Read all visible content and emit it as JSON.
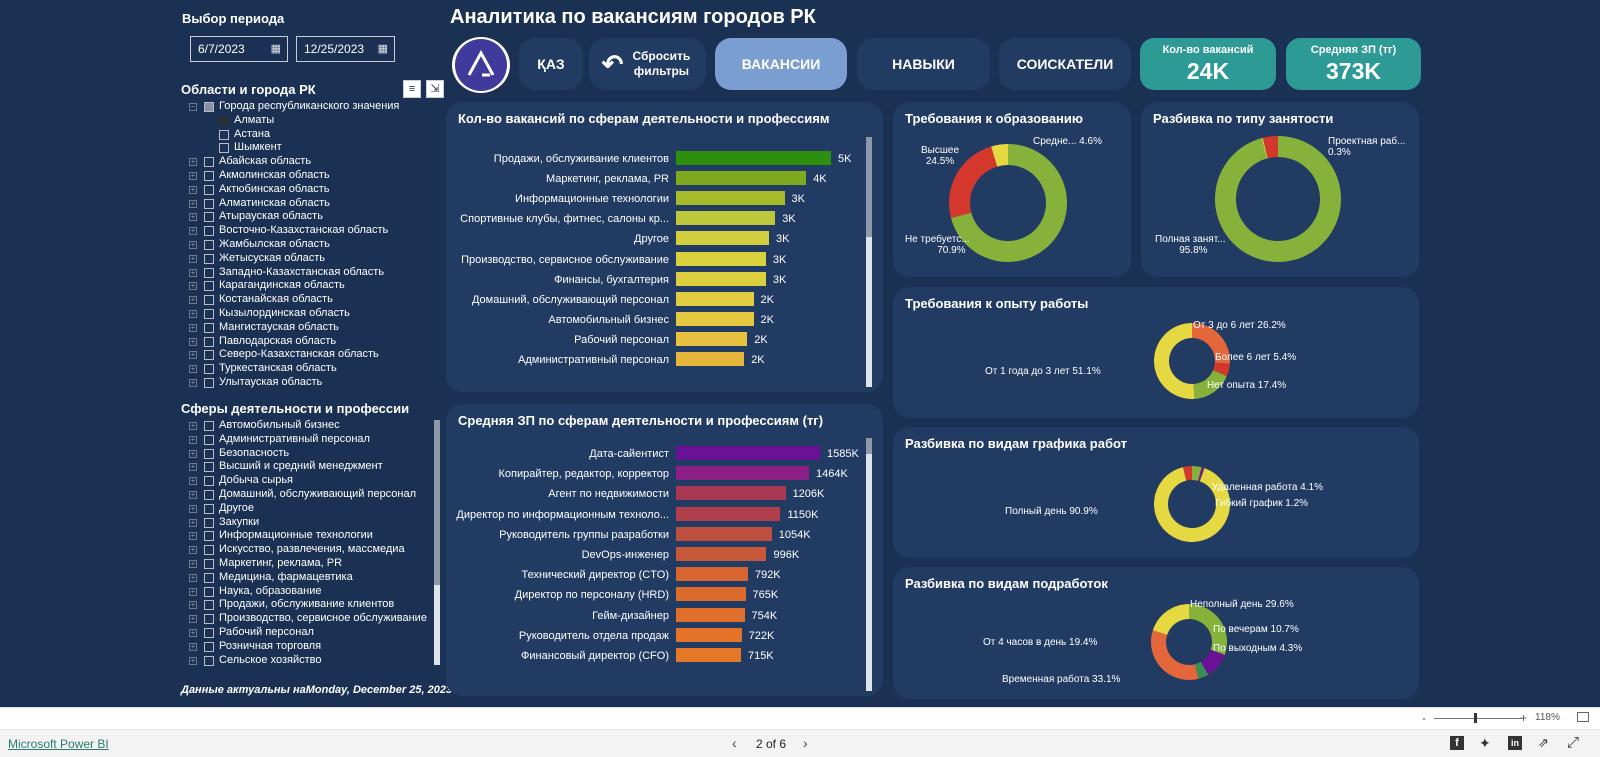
{
  "title": "Аналитика по вакансиям городов РК",
  "period": {
    "label": "Выбор периода",
    "start": "6/7/2023",
    "end": "12/25/2023"
  },
  "regions": {
    "label": "Области и города РК",
    "items": [
      {
        "label": "Города республиканского значения",
        "level": 0,
        "state": "partial"
      },
      {
        "label": "Алматы",
        "level": 1,
        "state": "filled"
      },
      {
        "label": "Астана",
        "level": 1,
        "state": "empty"
      },
      {
        "label": "Шымкент",
        "level": 1,
        "state": "empty"
      },
      {
        "label": "Абайская область",
        "level": 0,
        "state": "empty"
      },
      {
        "label": "Акмолинская область",
        "level": 0,
        "state": "empty"
      },
      {
        "label": "Актюбинская область",
        "level": 0,
        "state": "empty"
      },
      {
        "label": "Алматинская область",
        "level": 0,
        "state": "empty"
      },
      {
        "label": "Атырауская область",
        "level": 0,
        "state": "empty"
      },
      {
        "label": "Восточно-Казахстанская область",
        "level": 0,
        "state": "empty"
      },
      {
        "label": "Жамбылская область",
        "level": 0,
        "state": "empty"
      },
      {
        "label": "Жетысуская область",
        "level": 0,
        "state": "empty"
      },
      {
        "label": "Западно-Казахстанская область",
        "level": 0,
        "state": "empty"
      },
      {
        "label": "Карагандинская область",
        "level": 0,
        "state": "empty"
      },
      {
        "label": "Костанайская область",
        "level": 0,
        "state": "empty"
      },
      {
        "label": "Кызылординская область",
        "level": 0,
        "state": "empty"
      },
      {
        "label": "Мангистауская область",
        "level": 0,
        "state": "empty"
      },
      {
        "label": "Павлодарская область",
        "level": 0,
        "state": "empty"
      },
      {
        "label": "Северо-Казахстанская область",
        "level": 0,
        "state": "empty"
      },
      {
        "label": "Туркестанская область",
        "level": 0,
        "state": "empty"
      },
      {
        "label": "Улытауская область",
        "level": 0,
        "state": "empty"
      }
    ]
  },
  "spheres": {
    "label": "Сферы деятельности и профессии",
    "items": [
      "Автомобильный бизнес",
      "Административный персонал",
      "Безопасность",
      "Высший и средний менеджмент",
      "Добыча сырья",
      "Домашний, обслуживающий персонал",
      "Другое",
      "Закупки",
      "Информационные технологии",
      "Искусство, развлечения, массмедиа",
      "Маркетинг, реклама, PR",
      "Медицина, фармацевтика",
      "Наука, образование",
      "Продажи, обслуживание клиентов",
      "Производство, сервисное обслуживание",
      "Рабочий персонал",
      "Розничная торговля",
      "Сельское хозяйство"
    ]
  },
  "updated": {
    "prefix": "Данные актуальны на",
    "date": "Monday, December 25, 2023"
  },
  "nav": {
    "lang": "ҚАЗ",
    "reset": "Сбросить фильтры",
    "vacancies": "ВАКАНСИИ",
    "skills": "НАВЫКИ",
    "applicants": "СОИСКАТЕЛИ"
  },
  "kpis": [
    {
      "label": "Кол-во вакансий",
      "value": "24K"
    },
    {
      "label": "Средняя ЗП (тг)",
      "value": "373K"
    }
  ],
  "colors": {
    "background": "#1b3153",
    "card": "#223b63",
    "kpi": "#2e9a95",
    "active_tab": "#7b9ed0"
  },
  "chart_data": [
    {
      "id": "vacancies_by_sphere",
      "type": "bar",
      "orientation": "horizontal",
      "title": "Кол-во вакансий по сферам деятельности и профессиям",
      "categories": [
        "Продажи, обслуживание клиентов",
        "Маркетинг, реклама, PR",
        "Информационные технологии",
        "Спортивные клубы, фитнес, салоны кр...",
        "Другое",
        "Производство, сервисное обслуживание",
        "Финансы, бухгалтерия",
        "Домашний, обслуживающий персонал",
        "Автомобильный бизнес",
        "Рабочий персонал",
        "Административный персонал"
      ],
      "values": [
        5000,
        4200,
        3500,
        3200,
        3000,
        2900,
        2900,
        2500,
        2500,
        2300,
        2200
      ],
      "labels": [
        "5K",
        "4K",
        "3K",
        "3K",
        "3K",
        "3K",
        "3K",
        "2K",
        "2K",
        "2K",
        "2K"
      ],
      "colors": [
        "#2e8f0f",
        "#7fa91e",
        "#a6bc2b",
        "#bec63a",
        "#d2cf3e",
        "#d9d23c",
        "#dccf3d",
        "#e2cc42",
        "#e4c840",
        "#e6c240",
        "#e6b63a"
      ]
    },
    {
      "id": "salary_by_sphere",
      "type": "bar",
      "orientation": "horizontal",
      "title": "Средняя ЗП по сферам деятельности и профессиям (тг)",
      "categories": [
        "Дата-сайентист",
        "Копирайтер, редактор, корректор",
        "Агент по недвижимости",
        "Директор по информационным техноло...",
        "Руководитель группы разработки",
        "DevOps-инженер",
        "Технический директор (CTO)",
        "Директор по персоналу (HRD)",
        "Гейм-дизайнер",
        "Руководитель отдела продаж",
        "Финансовый директор (CFO)"
      ],
      "values": [
        1585,
        1464,
        1206,
        1150,
        1054,
        996,
        792,
        765,
        754,
        722,
        715
      ],
      "labels": [
        "1585K",
        "1464K",
        "1206K",
        "1150K",
        "1054K",
        "996K",
        "792K",
        "765K",
        "754K",
        "722K",
        "715K"
      ],
      "colors": [
        "#6a1296",
        "#8c1f86",
        "#a93852",
        "#b03f4b",
        "#bd4f40",
        "#c8583a",
        "#d86430",
        "#dc6a2b",
        "#df6f2a",
        "#e27329",
        "#e47828"
      ]
    },
    {
      "id": "education",
      "type": "pie",
      "title": "Требования к образованию",
      "slices": [
        {
          "label": "Не требуетс...",
          "value": 70.9,
          "text": "70.9%",
          "color": "#86b23b"
        },
        {
          "label": "Высшее",
          "value": 24.5,
          "text": "24.5%",
          "color": "#d4382c"
        },
        {
          "label": "Средне...",
          "value": 4.6,
          "text": "4.6%",
          "color": "#e5d841"
        }
      ]
    },
    {
      "id": "employment",
      "type": "pie",
      "title": "Разбивка по типу занятости",
      "slices": [
        {
          "label": "Полная занят...",
          "value": 95.8,
          "text": "95.8%",
          "color": "#86b23b"
        },
        {
          "label": "Проектная раб...",
          "value": 0.3,
          "text": "0.3%",
          "color": "#e5d841"
        },
        {
          "label": "",
          "value": 3.9,
          "text": "",
          "color": "#d4382c"
        }
      ]
    },
    {
      "id": "experience",
      "type": "pie",
      "title": "Требования к опыту работы",
      "slices": [
        {
          "label": "От 3 до 6 лет",
          "value": 26.2,
          "text": "26.2%",
          "color": "#e3673a"
        },
        {
          "label": "Более 6 лет",
          "value": 5.4,
          "text": "5.4%",
          "color": "#d4382c"
        },
        {
          "label": "Нет опыта",
          "value": 17.4,
          "text": "17.4%",
          "color": "#86b23b"
        },
        {
          "label": "От 1 года до 3 лет",
          "value": 51.1,
          "text": "51.1%",
          "color": "#e5d841"
        }
      ]
    },
    {
      "id": "schedule",
      "type": "pie",
      "title": "Разбивка по видам графика работ",
      "slices": [
        {
          "label": "Удаленная работа",
          "value": 4.1,
          "text": "4.1%",
          "color": "#86b23b"
        },
        {
          "label": "Гибкий график",
          "value": 1.2,
          "text": "1.2%",
          "color": "#7a1a88"
        },
        {
          "label": "Полный день",
          "value": 90.9,
          "text": "90.9%",
          "color": "#e5d841"
        },
        {
          "label": "",
          "value": 3.8,
          "text": "",
          "color": "#d4382c"
        }
      ]
    },
    {
      "id": "side_jobs",
      "type": "pie",
      "title": "Разбивка по видам подработок",
      "slices": [
        {
          "label": "Неполный день",
          "value": 29.6,
          "text": "29.6%",
          "color": "#86b23b"
        },
        {
          "label": "По вечерам",
          "value": 10.7,
          "text": "10.7%",
          "color": "#6a1296"
        },
        {
          "label": "По выходным",
          "value": 4.3,
          "text": "4.3%",
          "color": "#3b8d55"
        },
        {
          "label": "Временная работа",
          "value": 33.1,
          "text": "33.1%",
          "color": "#e3673a"
        },
        {
          "label": "От 4 часов в день",
          "value": 19.4,
          "text": "19.4%",
          "color": "#e5d841"
        }
      ]
    }
  ],
  "footer": {
    "brand": "Microsoft Power BI",
    "page": "2 of 6",
    "zoom": "118%",
    "zoom_minus": "-",
    "zoom_plus": "+"
  }
}
